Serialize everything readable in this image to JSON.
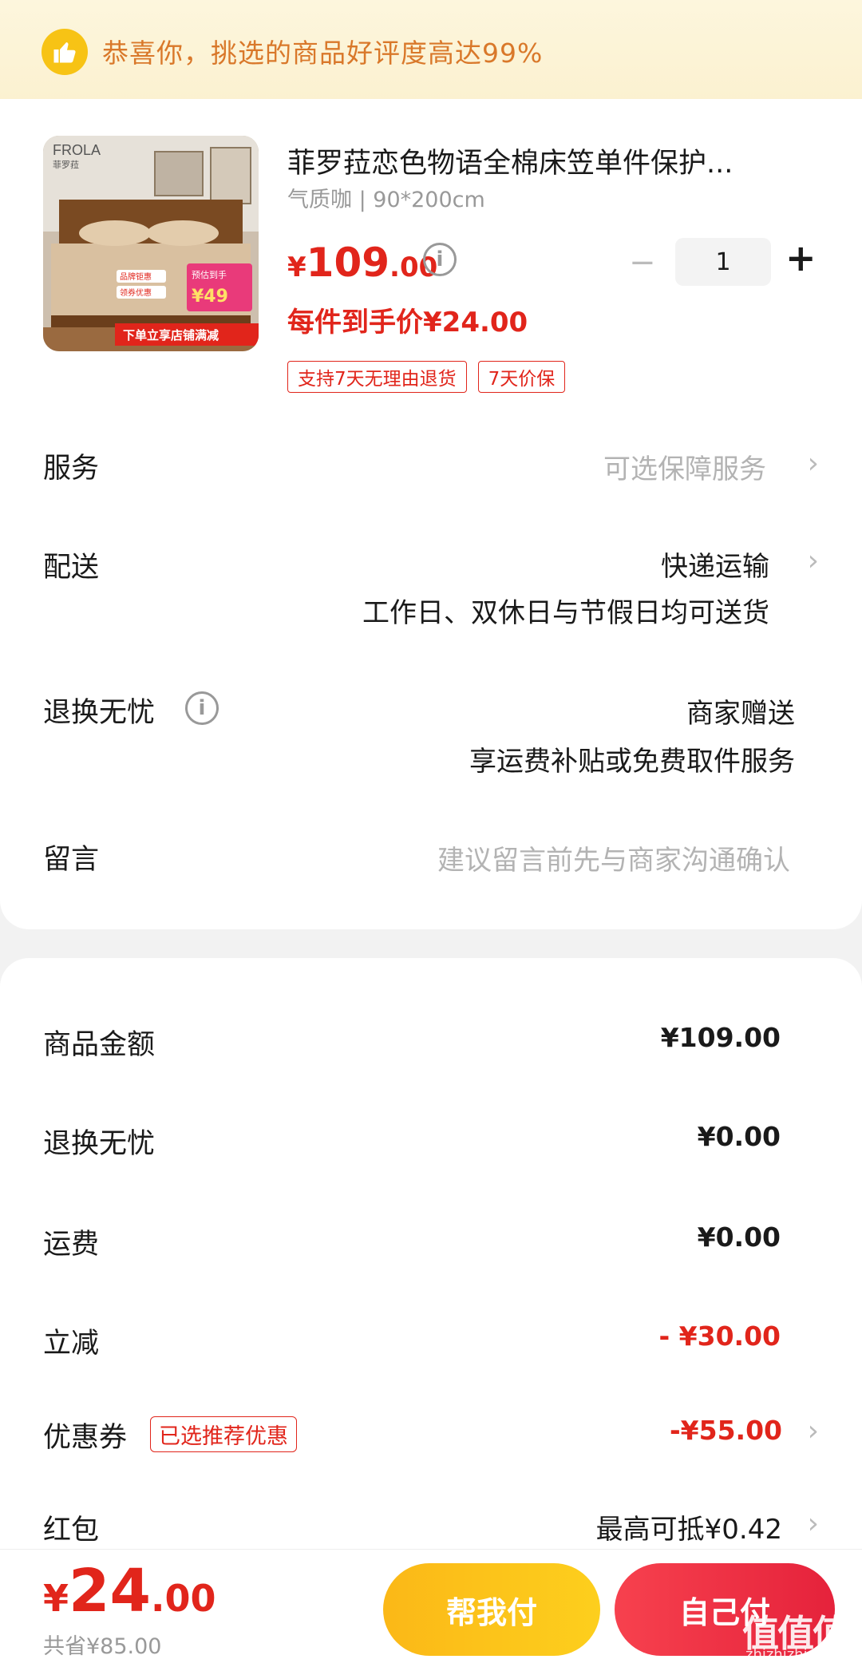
{
  "banner": {
    "text": "恭喜你，挑选的商品好评度高达99%",
    "icon": "thumbs-up-icon"
  },
  "product": {
    "title": "菲罗菈恋色物语全棉床笠单件保护...",
    "spec": "气质咖 | 90*200cm",
    "price_currency": "¥",
    "price_int": "109",
    "price_dec": ".00",
    "unit_price": "每件到手价¥24.00",
    "quantity": "1",
    "tags": [
      "支持7天无理由退货",
      "7天价保"
    ],
    "image_texts": {
      "brand": "FROLA",
      "brand_sub": "菲罗菈",
      "badge1": "品牌钜惠",
      "badge2": "领券优惠",
      "promo_price": "¥49",
      "promo_label": "预估到手",
      "strip": "下单立享店铺满减"
    }
  },
  "rows": {
    "service": {
      "label": "服务",
      "value": "可选保障服务"
    },
    "delivery": {
      "label": "配送",
      "value": "快递运输",
      "sub": "工作日、双休日与节假日均可送货"
    },
    "return": {
      "label": "退换无忧",
      "value": "商家赠送",
      "sub": "享运费补贴或免费取件服务"
    },
    "message": {
      "label": "留言",
      "placeholder": "建议留言前先与商家沟通确认"
    }
  },
  "summary": {
    "goods_amount": {
      "label": "商品金额",
      "value": "¥109.00"
    },
    "return_fee": {
      "label": "退换无忧",
      "value": "¥0.00"
    },
    "shipping": {
      "label": "运费",
      "value": "¥0.00"
    },
    "discount": {
      "label": "立减",
      "value": "- ¥30.00"
    },
    "coupon": {
      "label": "优惠券",
      "tag": "已选推荐优惠",
      "value": "-¥55.00"
    },
    "redpacket": {
      "label": "红包",
      "value": "最高可抵¥0.42"
    }
  },
  "bottom": {
    "total_cur": "¥",
    "total_int": "24",
    "total_dec": ".00",
    "saved": "共省¥85.00",
    "help_pay": "帮我付",
    "self_pay": "自己付",
    "watermark": "值值值",
    "watermark_url": "zhizhizhi.com"
  },
  "colors": {
    "accent": "#e1251b",
    "banner_text": "#d9782a",
    "yellow_button": "#fbb817",
    "red_button": "#e5223b"
  }
}
